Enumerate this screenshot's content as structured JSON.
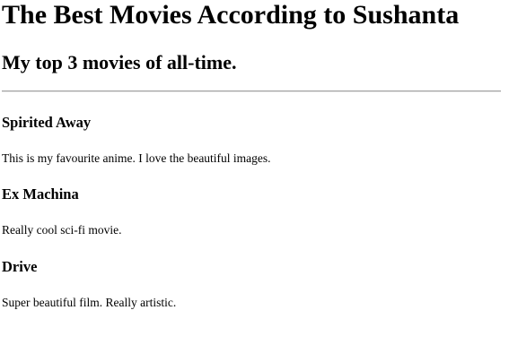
{
  "page": {
    "title": "The Best Movies According to Sushanta",
    "subtitle": "My top 3 movies of all-time."
  },
  "movies": [
    {
      "title": "Spirited Away",
      "description": "This is my favourite anime. I love the beautiful images."
    },
    {
      "title": "Ex Machina",
      "description": "Really cool sci-fi movie."
    },
    {
      "title": "Drive",
      "description": "Super beautiful film. Really artistic."
    }
  ]
}
